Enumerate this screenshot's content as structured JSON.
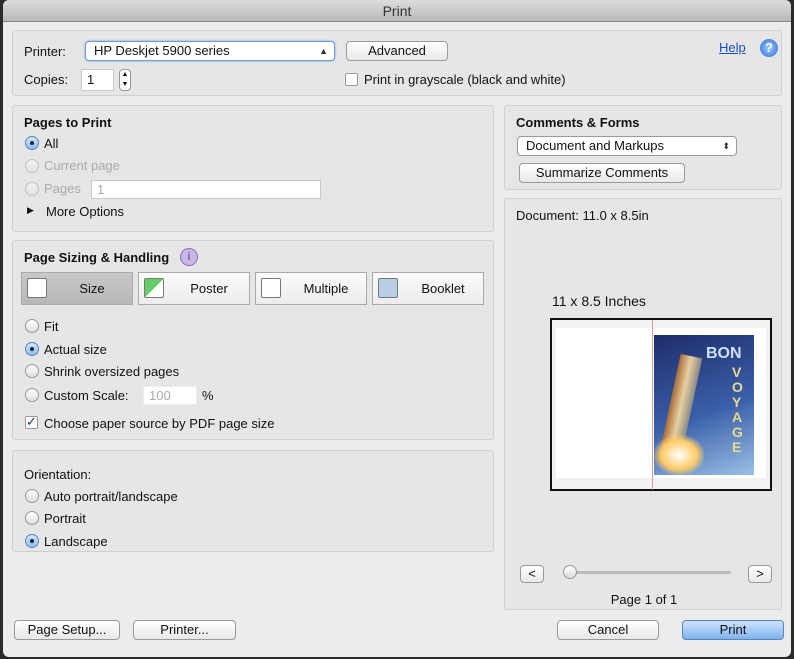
{
  "window": {
    "title": "Print"
  },
  "top": {
    "printer_label": "Printer:",
    "printer_value": "HP Deskjet 5900 series",
    "advanced": "Advanced",
    "help": "Help",
    "copies_label": "Copies:",
    "copies_value": "1",
    "grayscale": "Print in grayscale (black and white)",
    "grayscale_checked": false
  },
  "pages": {
    "title": "Pages to Print",
    "all": "All",
    "current": "Current page",
    "pages": "Pages",
    "pages_value": "1",
    "more": "More Options",
    "selected": "All"
  },
  "sizing": {
    "title": "Page Sizing & Handling",
    "tabs": [
      {
        "label": "Size",
        "icon": "size-icon"
      },
      {
        "label": "Poster",
        "icon": "poster-icon"
      },
      {
        "label": "Multiple",
        "icon": "multiple-icon"
      },
      {
        "label": "Booklet",
        "icon": "booklet-icon"
      }
    ],
    "selected_tab": "Size",
    "fit": "Fit",
    "actual": "Actual size",
    "shrink": "Shrink oversized pages",
    "custom": "Custom Scale:",
    "custom_value": "100",
    "percent": "%",
    "selected": "Actual size",
    "paper_source": "Choose paper source by PDF page size",
    "paper_source_checked": true
  },
  "orientation": {
    "title": "Orientation:",
    "auto": "Auto portrait/landscape",
    "portrait": "Portrait",
    "landscape": "Landscape",
    "selected": "Landscape"
  },
  "comments": {
    "title": "Comments & Forms",
    "value": "Document and Markups",
    "summarize": "Summarize Comments"
  },
  "preview": {
    "document": "Document: 11.0 x 8.5in",
    "size": "11 x 8.5 Inches",
    "poster_text": [
      "BON",
      "VOYAGE"
    ],
    "page": "Page 1 of 1",
    "prev": "<",
    "next": ">"
  },
  "bottom": {
    "page_setup": "Page Setup...",
    "printer": "Printer...",
    "cancel": "Cancel",
    "print": "Print"
  }
}
